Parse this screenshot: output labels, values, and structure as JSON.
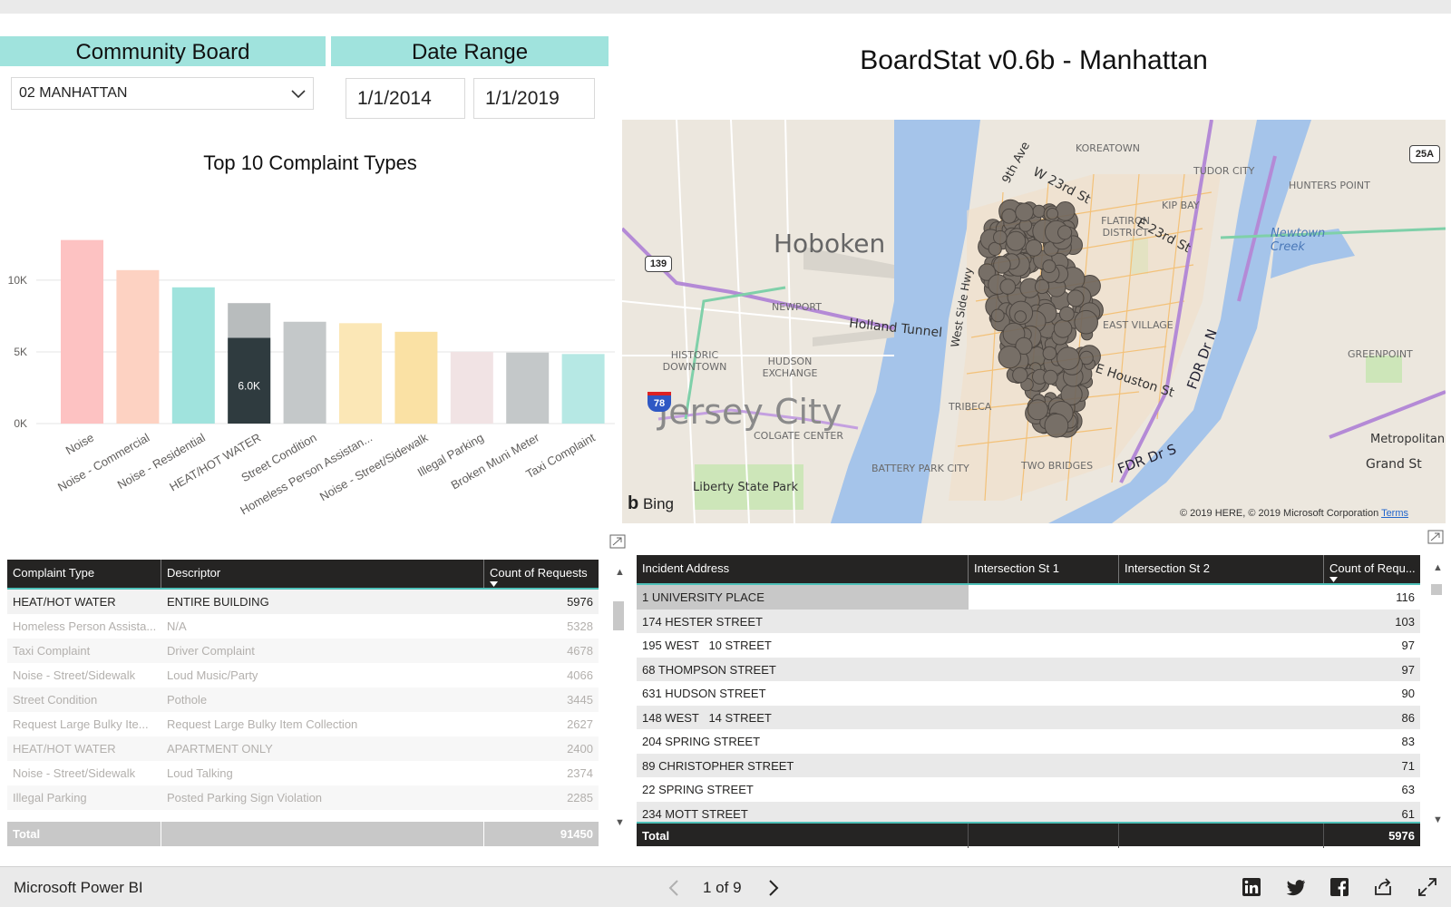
{
  "slicers": {
    "board_label": "Community Board",
    "date_label": "Date Range",
    "board_value": "02 MANHATTAN",
    "date_start": "1/1/2014",
    "date_end": "1/1/2019"
  },
  "report_title": "BoardStat v0.6b - Manhattan",
  "chart_data": {
    "type": "bar",
    "title": "Top 10 Complaint Types",
    "categories": [
      "Noise",
      "Noise - Commercial",
      "Noise - Residential",
      "HEAT/HOT WATER",
      "Street Condition",
      "Homeless Person Assistan...",
      "Noise - Street/Sidewalk",
      "Illegal Parking",
      "Broken Muni Meter",
      "Taxi Complaint"
    ],
    "values": [
      12800,
      10700,
      9500,
      8400,
      7100,
      7000,
      6400,
      5000,
      4950,
      4850
    ],
    "highlight_value": 5976,
    "highlight_label": "6.0K",
    "highlight_category": "HEAT/HOT WATER",
    "yticks": [
      "0K",
      "5K",
      "10K"
    ],
    "ylim": [
      0,
      15000
    ],
    "grid": true,
    "colors": [
      "#fdc2c2",
      "#fdd2c2",
      "#a0e3dd",
      "#b8bcbd",
      "#c4c8c9",
      "#fbe7b6",
      "#fae1a4",
      "#f1e3e4",
      "#c4c8c9",
      "#b6e8e4"
    ],
    "highlight_color": "#2f3b3f"
  },
  "map": {
    "labels": {
      "hoboken": "Hoboken",
      "jersey_city": "Jersey City",
      "holland_tunnel": "Holland Tunnel",
      "newport": "NEWPORT",
      "historic_downtown": "HISTORIC DOWNTOWN",
      "hudson_exchange": "HUDSON EXCHANGE",
      "colgate_center": "COLGATE CENTER",
      "liberty_state_park": "Liberty State Park",
      "battery_park_city": "BATTERY PARK CITY",
      "tribeca": "TRIBECA",
      "two_bridges": "TWO BRIDGES",
      "east_village": "EAST VILLAGE",
      "flatiron": "FLATIRON DISTRICT",
      "koreatown": "KOREATOWN",
      "tudor_city": "TUDOR CITY",
      "kip_bay": "KIP BAY",
      "hunters_point": "HUNTERS POINT",
      "newtown_creek": "Newtown Creek",
      "greenpoint": "GREENPOINT",
      "metropolitan": "Metropolitan",
      "grand_st": "Grand St",
      "e_houston": "E Houston St",
      "w_23rd": "W 23rd St",
      "e_23rd": "E 23rd St",
      "fdr_dr_s": "FDR Dr S",
      "fdr_dr_n": "FDR Dr N",
      "west_side_hwy": "West Side Hwy",
      "ninth_ave": "9th Ave",
      "bing": "Bing",
      "copyright": "© 2019 HERE, © 2019 Microsoft Corporation",
      "terms": "Terms",
      "shield_139": "139",
      "shield_78": "78",
      "shield_25a": "25A"
    }
  },
  "table_left": {
    "headers": [
      "Complaint Type",
      "Descriptor",
      "Count of Requests"
    ],
    "rows": [
      [
        "HEAT/HOT WATER",
        "ENTIRE BUILDING",
        "5976"
      ],
      [
        "Homeless Person Assista...",
        "N/A",
        "5328"
      ],
      [
        "Taxi Complaint",
        "Driver Complaint",
        "4678"
      ],
      [
        "Noise - Street/Sidewalk",
        "Loud Music/Party",
        "4066"
      ],
      [
        "Street Condition",
        "Pothole",
        "3445"
      ],
      [
        "Request Large Bulky Ite...",
        "Request Large Bulky Item Collection",
        "2627"
      ],
      [
        "HEAT/HOT WATER",
        "APARTMENT ONLY",
        "2400"
      ],
      [
        "Noise - Street/Sidewalk",
        "Loud Talking",
        "2374"
      ],
      [
        "Illegal Parking",
        "Posted Parking Sign Violation",
        "2285"
      ]
    ],
    "total_label": "Total",
    "total_value": "91450"
  },
  "table_right": {
    "headers": [
      "Incident Address",
      "Intersection St 1",
      "Intersection St 2",
      "Count of Requ..."
    ],
    "rows": [
      [
        "1 UNIVERSITY PLACE",
        "116"
      ],
      [
        "174 HESTER STREET",
        "103"
      ],
      [
        "195 WEST   10 STREET",
        "97"
      ],
      [
        "68 THOMPSON STREET",
        "97"
      ],
      [
        "631 HUDSON STREET",
        "90"
      ],
      [
        "148 WEST   14 STREET",
        "86"
      ],
      [
        "204 SPRING STREET",
        "83"
      ],
      [
        "89 CHRISTOPHER STREET",
        "71"
      ],
      [
        "22 SPRING STREET",
        "63"
      ],
      [
        "234 MOTT STREET",
        "61"
      ]
    ],
    "total_label": "Total",
    "total_value": "5976"
  },
  "footer": {
    "brand": "Microsoft Power BI",
    "page_indicator": "1 of 9"
  }
}
